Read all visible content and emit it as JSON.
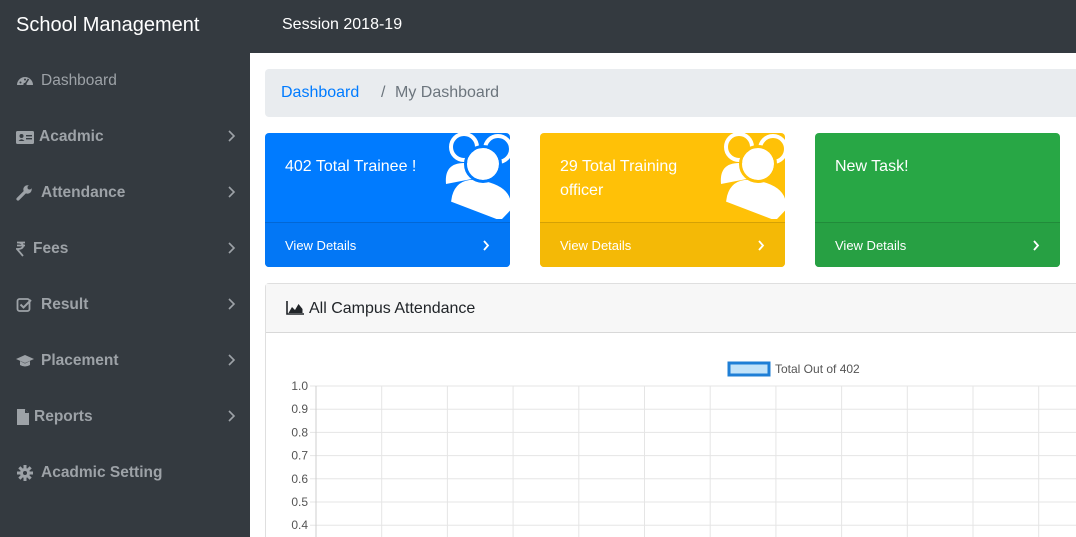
{
  "header": {
    "brand": "School Management",
    "session": "Session 2018-19"
  },
  "sidebar": {
    "items": [
      {
        "label": "Dashboard",
        "icon": "dashboard-icon",
        "has_chevron": false
      },
      {
        "label": "Acadmic",
        "icon": "id-card-icon",
        "has_chevron": true
      },
      {
        "label": "Attendance",
        "icon": "wrench-icon",
        "has_chevron": true
      },
      {
        "label": "Fees",
        "icon": "rupee-icon",
        "has_chevron": true
      },
      {
        "label": "Result",
        "icon": "check-square-icon",
        "has_chevron": true
      },
      {
        "label": "Placement",
        "icon": "graduation-cap-icon",
        "has_chevron": true
      },
      {
        "label": "Reports",
        "icon": "file-icon",
        "has_chevron": true
      },
      {
        "label": "Acadmic Setting",
        "icon": "gear-icon",
        "has_chevron": false
      }
    ]
  },
  "breadcrumb": {
    "link": "Dashboard",
    "separator": "/",
    "current": "My Dashboard"
  },
  "cards": [
    {
      "title": "402 Total Trainee !",
      "footer": "View Details",
      "color": "#007bff",
      "icon": "users-icon"
    },
    {
      "title": "29 Total Training officer",
      "footer": "View Details",
      "color": "#ffc107",
      "icon": "users-icon"
    },
    {
      "title": "New Task!",
      "footer": "View Details",
      "color": "#28a745",
      "icon": ""
    }
  ],
  "panel": {
    "title": "All Campus Attendance",
    "icon": "area-chart-icon"
  },
  "chart_data": {
    "type": "bar",
    "title": "",
    "categories": [],
    "series": [
      {
        "name": "Total Out of 402",
        "values": []
      }
    ],
    "y_ticks": [
      "1.0",
      "0.9",
      "0.8",
      "0.7",
      "0.6",
      "0.5",
      "0.4"
    ],
    "ylim": [
      0,
      1
    ],
    "grid": true,
    "legend": "top"
  }
}
